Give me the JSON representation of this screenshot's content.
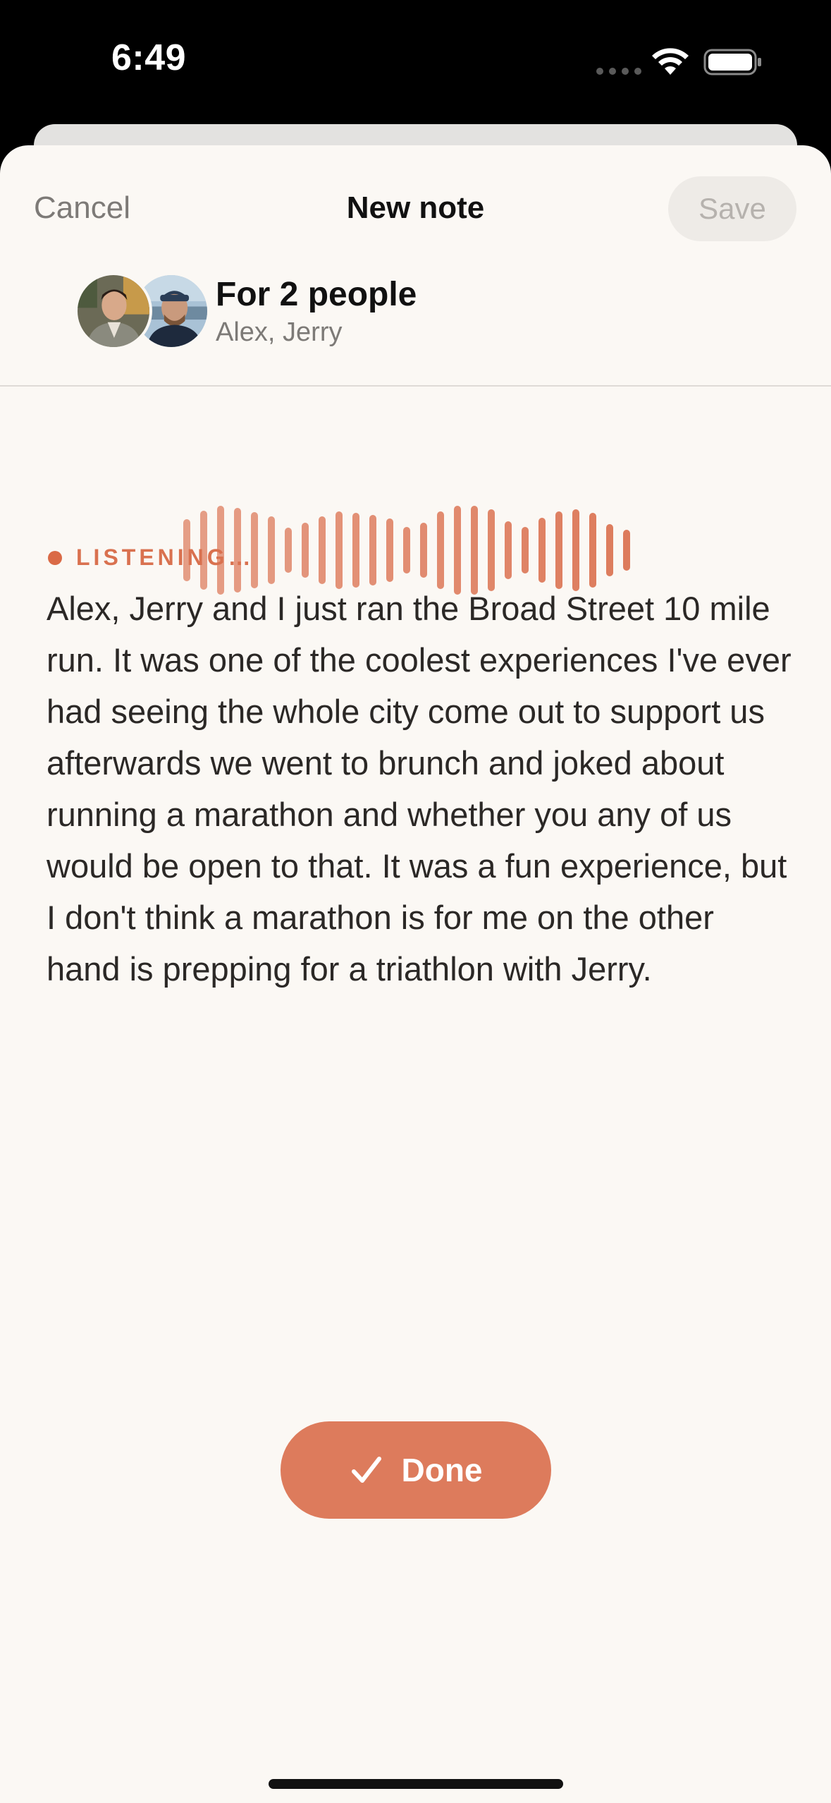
{
  "status_bar": {
    "time": "6:49"
  },
  "header": {
    "cancel_label": "Cancel",
    "title": "New note",
    "save_label": "Save"
  },
  "recipients": {
    "title": "For 2 people",
    "names": "Alex, Jerry"
  },
  "recording": {
    "status_label": "LISTENING…",
    "transcript": "Alex, Jerry and I just ran the Broad Street 10 mile run. It was one of the coolest experiences I've ever had seeing the whole city come out to support us afterwards we went to brunch and joked about running a marathon and whether you any of us would be open to that. It was a fun experience, but I don't think a marathon is for me on the other hand is prepping for a triathlon with Jerry."
  },
  "actions": {
    "done_label": "Done"
  },
  "icons": {
    "done": "checkmark-icon",
    "wifi": "wifi-icon",
    "battery": "battery-icon"
  },
  "colors": {
    "accent": "#dd7b5c",
    "sheet_background": "#fbf8f4",
    "status_bar_background": "#000000"
  }
}
